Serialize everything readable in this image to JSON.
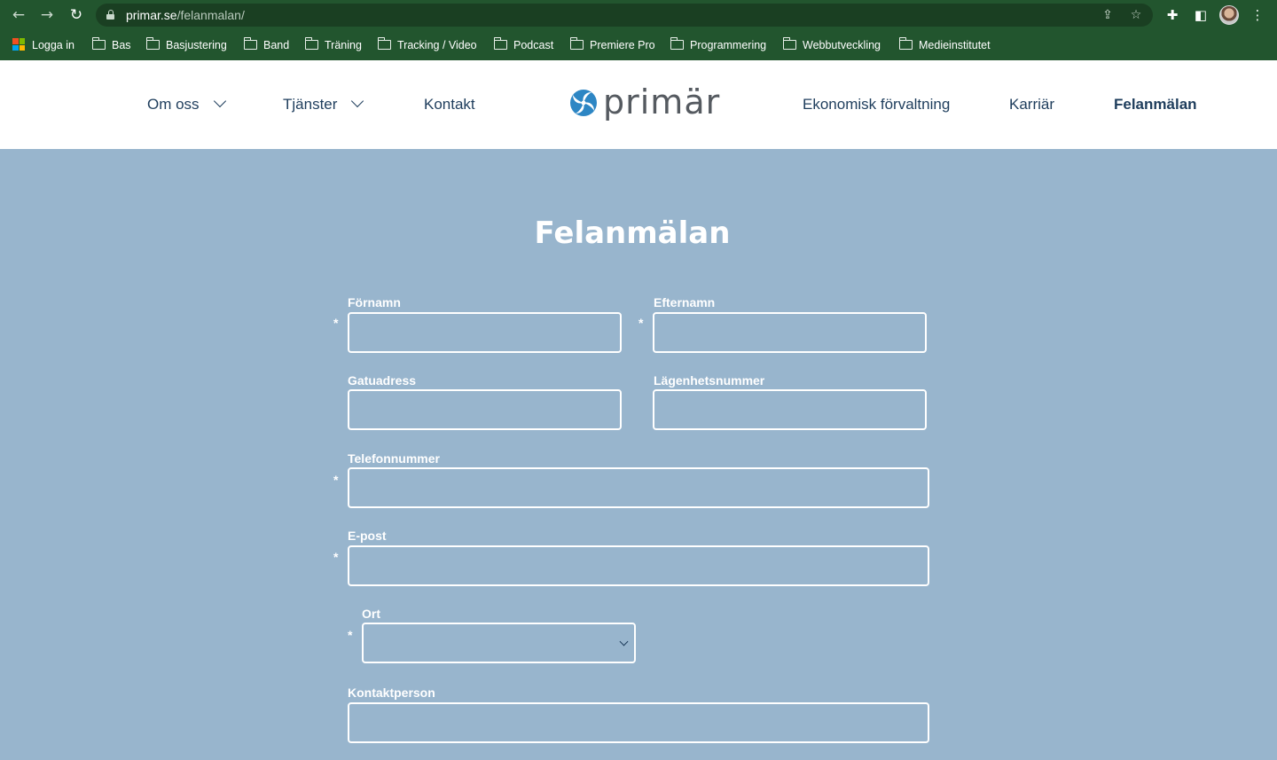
{
  "browser": {
    "url_host": "primar.se",
    "url_path": "/felanmalan/",
    "icons": [
      "back-icon",
      "forward-icon",
      "reload-icon",
      "lock-icon",
      "share-icon",
      "star-icon",
      "extensions-icon",
      "sidebar-icon",
      "menu-icon"
    ],
    "bookmarks": [
      {
        "label": "Logga in",
        "icon": "microsoft-icon"
      },
      {
        "label": "Bas",
        "icon": "folder-icon"
      },
      {
        "label": "Basjustering",
        "icon": "folder-icon"
      },
      {
        "label": "Band",
        "icon": "folder-icon"
      },
      {
        "label": "Träning",
        "icon": "folder-icon"
      },
      {
        "label": "Tracking / Video",
        "icon": "folder-icon"
      },
      {
        "label": "Podcast",
        "icon": "folder-icon"
      },
      {
        "label": "Premiere Pro",
        "icon": "folder-icon"
      },
      {
        "label": "Programmering",
        "icon": "folder-icon"
      },
      {
        "label": "Webbutveckling",
        "icon": "folder-icon"
      },
      {
        "label": "Medieinstitutet",
        "icon": "folder-icon"
      }
    ]
  },
  "header": {
    "logo_text": "primär",
    "nav_left": [
      {
        "label": "Om oss",
        "has_dropdown": true
      },
      {
        "label": "Tjänster",
        "has_dropdown": true
      },
      {
        "label": "Kontakt",
        "has_dropdown": false
      }
    ],
    "nav_right": [
      {
        "label": "Ekonomisk förvaltning",
        "active": false
      },
      {
        "label": "Karriär",
        "active": false
      },
      {
        "label": "Felanmälan",
        "active": true
      }
    ]
  },
  "form": {
    "title": "Felanmälan",
    "required_mark": "*",
    "fields": {
      "fornamn": {
        "label": "Förnamn",
        "value": "",
        "required": true
      },
      "efternamn": {
        "label": "Efternamn",
        "value": "",
        "required": true
      },
      "gatuadress": {
        "label": "Gatuadress",
        "value": "",
        "required": false
      },
      "lagenhetsnummer": {
        "label": "Lägenhetsnummer",
        "value": "",
        "required": false
      },
      "telefonnummer": {
        "label": "Telefonnummer",
        "value": "",
        "required": true
      },
      "epost": {
        "label": "E-post",
        "value": "",
        "required": true
      },
      "ort": {
        "label": "Ort",
        "selected": "",
        "required": true
      },
      "kontaktperson": {
        "label": "Kontaktperson",
        "value": "",
        "required": false
      }
    }
  },
  "colors": {
    "page_background": "#98b5cd",
    "chrome_background": "#22552e",
    "nav_text": "#1e3d5c",
    "field_border": "#ffffff"
  }
}
